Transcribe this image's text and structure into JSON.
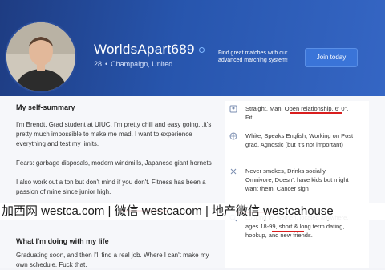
{
  "profile": {
    "username": "WorldsApart689",
    "age": "28",
    "location": "Champaign, United ..."
  },
  "promo": {
    "text": "Find great matches with our advanced matching system!",
    "button_label": "Join today"
  },
  "summary": {
    "title": "My self-summary",
    "paragraphs": [
      "I'm Brendt. Grad student at UIUC. I'm pretty chill and easy going...it's pretty much impossible to make me mad. I want to experience everything and test my limits.",
      "Fears: garbage disposals, modern windmills, Japanese giant hornets",
      "I also work out a ton but don't mind if you don't. Fitness has been a passion of mine since junior high."
    ]
  },
  "doing": {
    "title": "What I'm doing with my life",
    "paragraph": "Graduating soon, and then I'll find a real job. Where I can't make my own schedule. Fuck that."
  },
  "details": [
    {
      "icon": "person-icon",
      "text": "Straight, Man, Open relationship, 6' 0\", Fit"
    },
    {
      "icon": "globe-icon",
      "text": "White, Speaks English, Working on Post grad, Agnostic (but it's not important)"
    },
    {
      "icon": "lifestyle-icon",
      "text": "Never smokes, Drinks socially, Omnivore, Doesn't have kids but might want them, Cancer sign"
    },
    {
      "icon": "search-icon",
      "text": "Looking for women, located anywhere, ages 18-99, short & long term dating, hookup, and new friends."
    }
  ],
  "watermark": {
    "text": "加西网 westca.com | 微信 westcacom | 地产微信 westcahouse"
  },
  "colors": {
    "header_dark": "#1e3c82",
    "header_light": "#3566c4",
    "button": "#3a74d8",
    "annotation_red": "#d91e1e"
  }
}
